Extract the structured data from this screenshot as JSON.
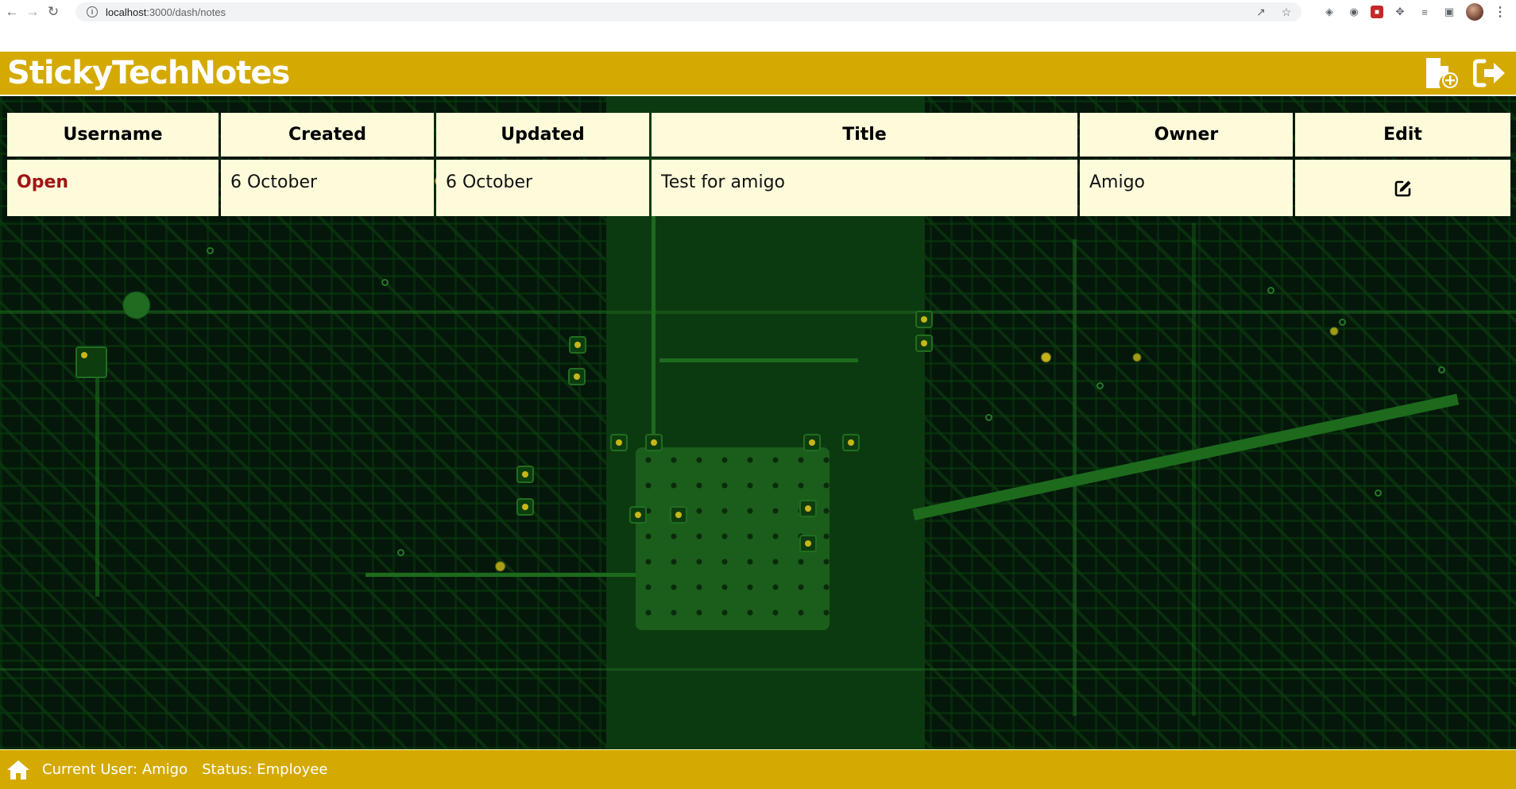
{
  "browser": {
    "url_host": "localhost",
    "url_path": ":3000/dash/notes"
  },
  "app": {
    "title": "StickyTechNotes",
    "header_actions": [
      {
        "name": "new-note-icon"
      },
      {
        "name": "logout-icon"
      }
    ]
  },
  "table": {
    "headers": [
      "Username",
      "Created",
      "Updated",
      "Title",
      "Owner",
      "Edit"
    ],
    "rows": [
      {
        "status": "Open",
        "created": "6 October",
        "updated": "6 October",
        "title": "Test for amigo",
        "owner": "Amigo",
        "edit_icon": "edit-icon"
      }
    ]
  },
  "footer": {
    "current_user": "Current User: Amigo",
    "status": "Status: Employee"
  },
  "colors": {
    "brand": "#d4aa02",
    "table_cell": "#fefbdb",
    "status_open": "#a01515"
  }
}
